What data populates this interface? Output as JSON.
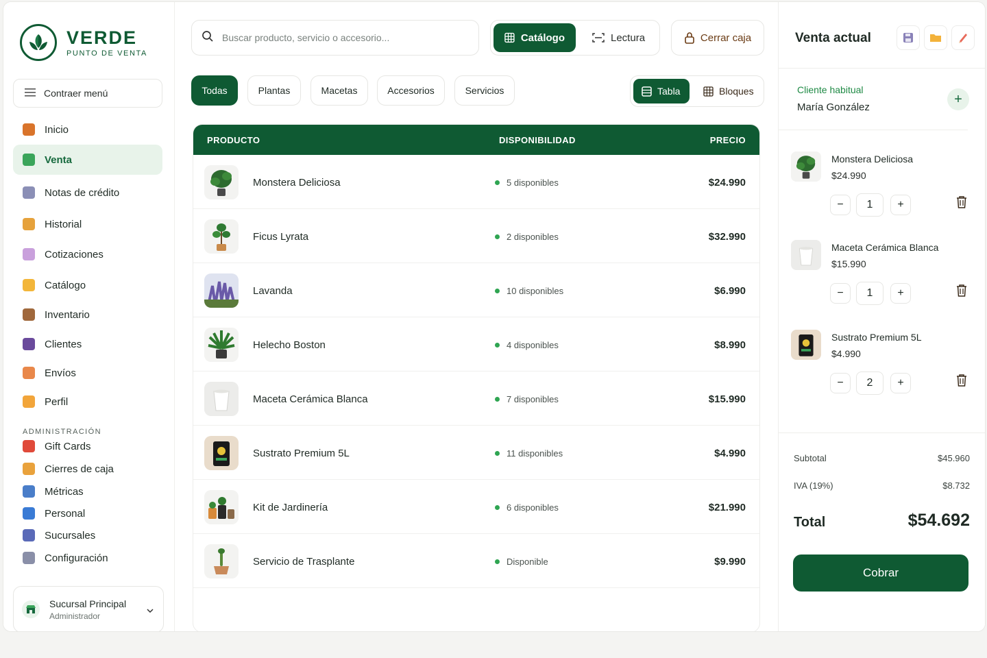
{
  "brand": {
    "name": "VERDE",
    "subtitle": "PUNTO DE VENTA"
  },
  "sidebar": {
    "collapse_label": "Contraer menú",
    "items": [
      {
        "label": "Inicio",
        "icon": "home-icon",
        "color": "#d9742b"
      },
      {
        "label": "Venta",
        "icon": "cart-icon",
        "color": "#3aa55a",
        "active": true
      },
      {
        "label": "Notas de crédito",
        "icon": "credit-note-icon",
        "color": "#8b8fb6"
      },
      {
        "label": "Historial",
        "icon": "history-icon",
        "color": "#e6a23c"
      },
      {
        "label": "Cotizaciones",
        "icon": "quote-icon",
        "color": "#c9a0dc"
      },
      {
        "label": "Catálogo",
        "icon": "tag-icon",
        "color": "#f3b63a"
      },
      {
        "label": "Inventario",
        "icon": "box-icon",
        "color": "#a0683c"
      },
      {
        "label": "Clientes",
        "icon": "users-icon",
        "color": "#6a4a9c"
      },
      {
        "label": "Envíos",
        "icon": "truck-icon",
        "color": "#e9884a"
      },
      {
        "label": "Perfil",
        "icon": "face-icon",
        "color": "#f2a53a"
      }
    ],
    "admin_label": "ADMINISTRACIÓN",
    "admin_items": [
      {
        "label": "Gift Cards",
        "icon": "gift-icon",
        "color": "#e04a3a"
      },
      {
        "label": "Cierres de caja",
        "icon": "money-bag-icon",
        "color": "#e9a23c"
      },
      {
        "label": "Métricas",
        "icon": "chart-icon",
        "color": "#4a7ec9"
      },
      {
        "label": "Personal",
        "icon": "id-card-icon",
        "color": "#3a7bd5"
      },
      {
        "label": "Sucursales",
        "icon": "building-icon",
        "color": "#5a6ab8"
      },
      {
        "label": "Configuración",
        "icon": "gear-icon",
        "color": "#8a8fa8"
      }
    ],
    "branch": {
      "name": "Sucursal Principal",
      "role": "Administrador"
    }
  },
  "topbar": {
    "search_placeholder": "Buscar producto, servicio o accesorio...",
    "mode_catalog": "Catálogo",
    "mode_reading": "Lectura",
    "close_cash": "Cerrar caja"
  },
  "filters": [
    "Todas",
    "Plantas",
    "Macetas",
    "Accesorios",
    "Servicios"
  ],
  "view": {
    "table": "Tabla",
    "blocks": "Bloques"
  },
  "table": {
    "headers": {
      "product": "PRODUCTO",
      "availability": "DISPONIBILIDAD",
      "price": "PRECIO"
    },
    "rows": [
      {
        "name": "Monstera Deliciosa",
        "availability": "5 disponibles",
        "price": "$24.990",
        "image": "monstera-plant"
      },
      {
        "name": "Ficus Lyrata",
        "availability": "2 disponibles",
        "price": "$32.990",
        "image": "ficus-plant"
      },
      {
        "name": "Lavanda",
        "availability": "10 disponibles",
        "price": "$6.990",
        "image": "lavender-plant"
      },
      {
        "name": "Helecho Boston",
        "availability": "4 disponibles",
        "price": "$8.990",
        "image": "fern-plant"
      },
      {
        "name": "Maceta Cerámica Blanca",
        "availability": "7 disponibles",
        "price": "$15.990",
        "image": "white-pot"
      },
      {
        "name": "Sustrato Premium 5L",
        "availability": "11 disponibles",
        "price": "$4.990",
        "image": "soil-bag"
      },
      {
        "name": "Kit de Jardinería",
        "availability": "6 disponibles",
        "price": "$21.990",
        "image": "garden-kit"
      },
      {
        "name": "Servicio de Trasplante",
        "availability": "Disponible",
        "price": "$9.990",
        "image": "transplant-service"
      }
    ]
  },
  "cart": {
    "title": "Venta actual",
    "customer_label": "Cliente habitual",
    "customer_name": "María González",
    "items": [
      {
        "name": "Monstera Deliciosa",
        "price": "$24.990",
        "qty": "1",
        "image": "monstera-plant"
      },
      {
        "name": "Maceta Cerámica Blanca",
        "price": "$15.990",
        "qty": "1",
        "image": "white-pot"
      },
      {
        "name": "Sustrato Premium 5L",
        "price": "$4.990",
        "qty": "2",
        "image": "soil-bag"
      }
    ],
    "subtotal_label": "Subtotal",
    "subtotal": "$45.960",
    "tax_label": "IVA (19%)",
    "tax": "$8.732",
    "total_label": "Total",
    "total": "$54.692",
    "pay_label": "Cobrar"
  },
  "colors": {
    "primary": "#0f5a33",
    "accent_light": "#e8f3ea",
    "status_green": "#2fa552"
  }
}
